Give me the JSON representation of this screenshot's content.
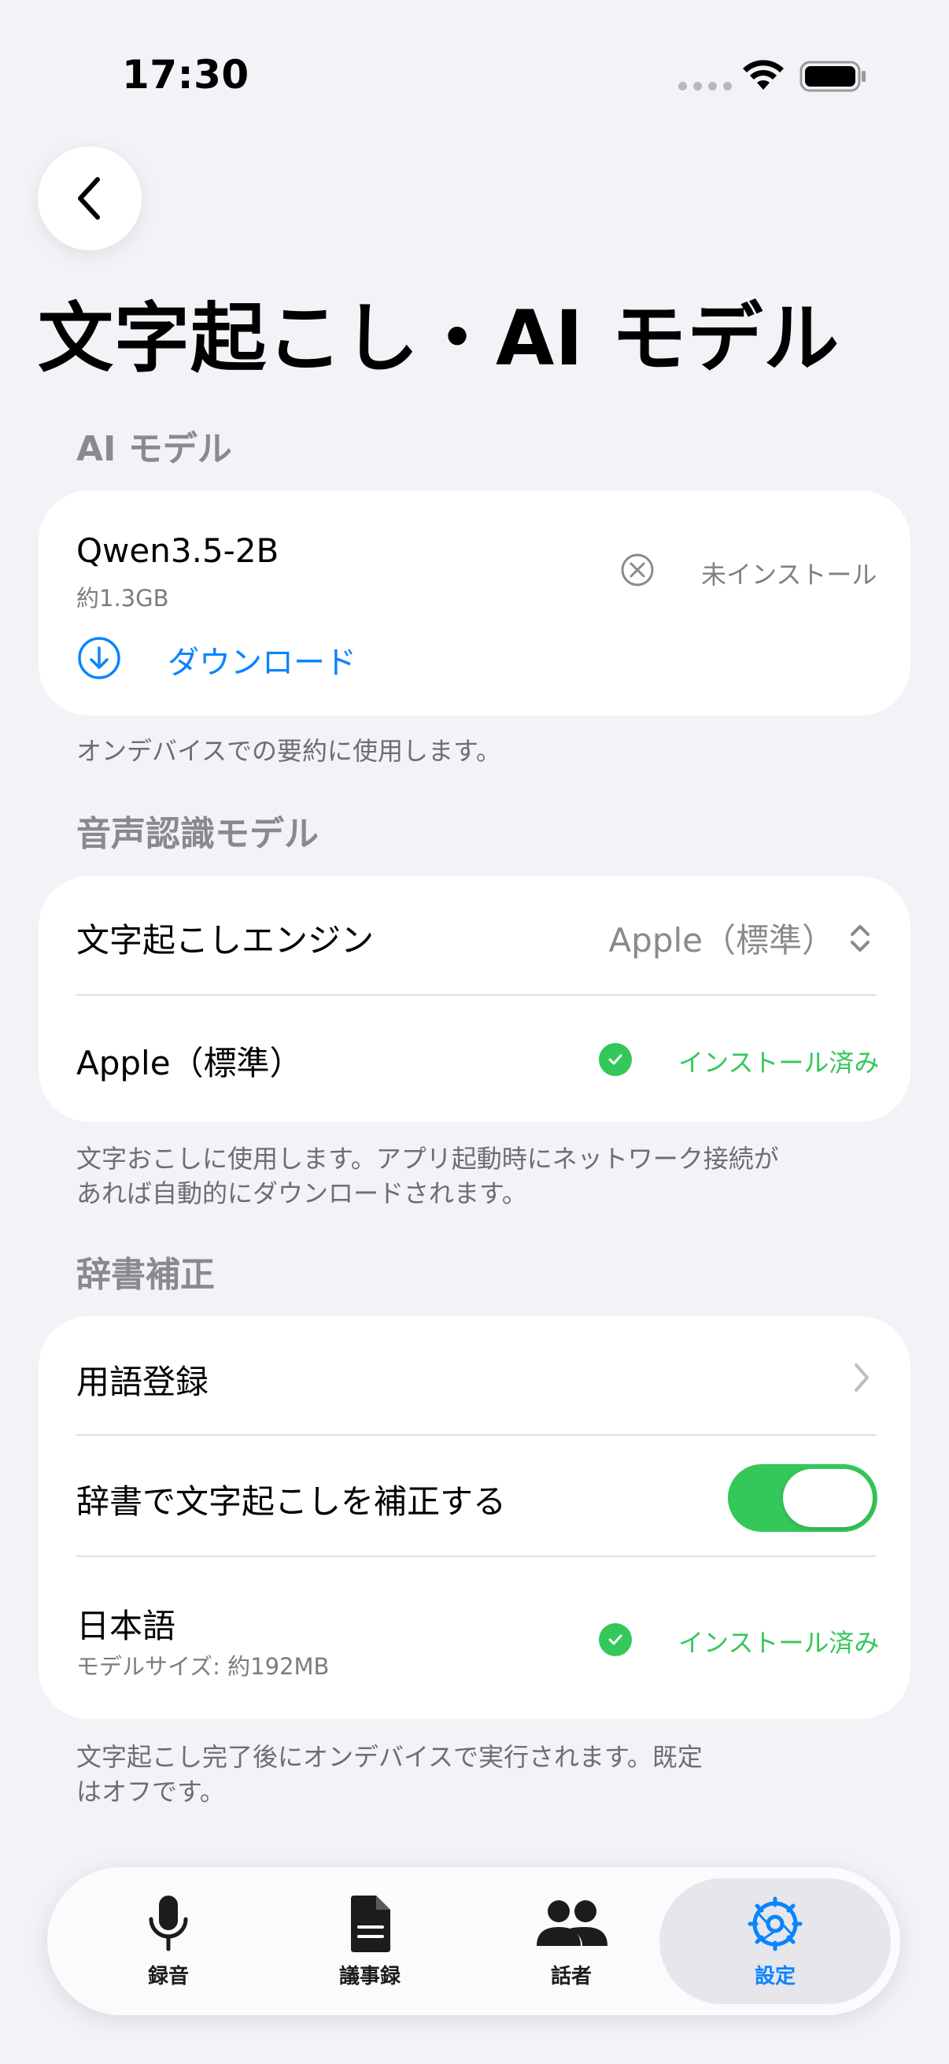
{
  "status_bar": {
    "time": "17:30"
  },
  "page": {
    "title": "文字起こし・AI モデル"
  },
  "ai_model": {
    "section_title": "AI モデル",
    "model_name": "Qwen3.5-2B",
    "model_size": "約1.3GB",
    "install_status": "未インストール",
    "download_label": "ダウンロード",
    "footnote": "オンデバイスでの要約に使用します。"
  },
  "speech_model": {
    "section_title": "音声認識モデル",
    "engine_label": "文字起こしエンジン",
    "engine_value": "Apple（標準）",
    "apple_label": "Apple（標準）",
    "apple_status": "インストール済み",
    "footnote_line1": "文字おこしに使用します。アプリ起動時にネットワーク接続が",
    "footnote_line2": "あれば自動的にダウンロードされます。"
  },
  "dictionary": {
    "section_title": "辞書補正",
    "term_registration_label": "用語登録",
    "correction_toggle_label": "辞書で文字起こしを補正する",
    "correction_enabled": true,
    "language_label": "日本語",
    "language_model_size": "モデルサイズ: 約192MB",
    "language_status": "インストール済み",
    "footnote_line1": "文字起こし完了後にオンデバイスで実行されます。既定",
    "footnote_line2": "はオフです。"
  },
  "tab_bar": {
    "tabs": [
      {
        "label": "録音",
        "icon": "microphone-icon"
      },
      {
        "label": "議事録",
        "icon": "document-icon"
      },
      {
        "label": "話者",
        "icon": "people-icon"
      },
      {
        "label": "設定",
        "icon": "gear-icon",
        "active": true
      }
    ]
  },
  "colors": {
    "accent": "#0a84ff",
    "success": "#34c759",
    "background": "#f2f2f7"
  }
}
